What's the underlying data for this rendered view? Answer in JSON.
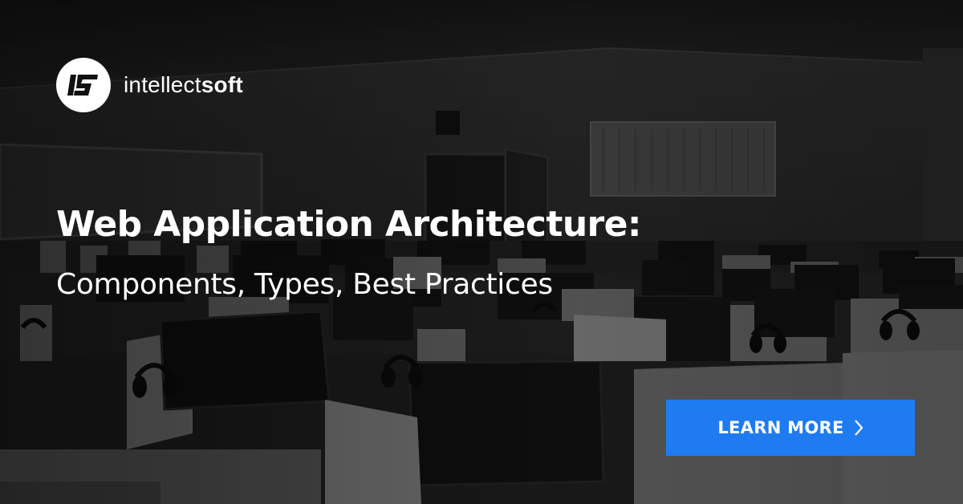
{
  "brand": {
    "name_light": "intellect",
    "name_bold": "soft",
    "logo_icon": "is-monogram-icon"
  },
  "headline": {
    "title": "Web Application Architecture:",
    "subtitle": "Components, Types, Best Practices"
  },
  "cta": {
    "label": "LEARN MORE",
    "icon": "chevron-right-icon"
  },
  "colors": {
    "cta_background": "#1E7BF2",
    "text": "#FFFFFF",
    "overlay": "#1F1F1F"
  }
}
